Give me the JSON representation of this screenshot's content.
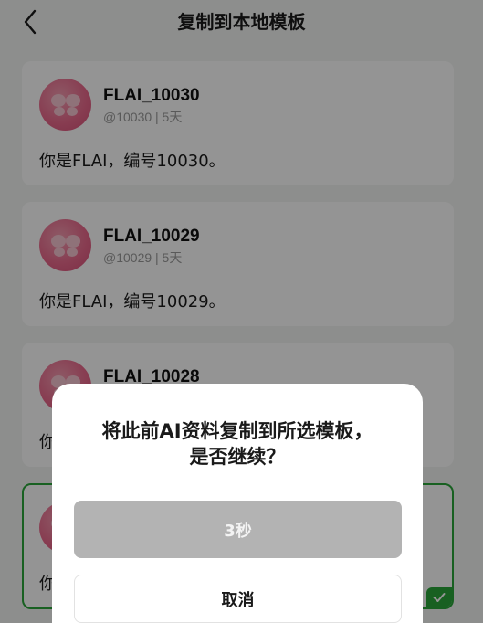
{
  "header": {
    "title": "复制到本地模板"
  },
  "templates": [
    {
      "name": "FLAI_10030",
      "meta": "@10030 | 5天",
      "desc": "你是FLAI，编号10030。"
    },
    {
      "name": "FLAI_10029",
      "meta": "@10029 | 5天",
      "desc": "你是FLAI，编号10029。"
    },
    {
      "name": "FLAI_10028",
      "meta": "",
      "desc": "你"
    },
    {
      "name": "",
      "meta": "",
      "desc": "你"
    }
  ],
  "dialog": {
    "message_line1": "将此前AI资料复制到所选模板，",
    "message_line2": "是否继续？",
    "confirm_label": "3秒",
    "cancel_label": "取消"
  },
  "colors": {
    "accent": "#2aa63a",
    "avatar": "#ea6a8d"
  }
}
